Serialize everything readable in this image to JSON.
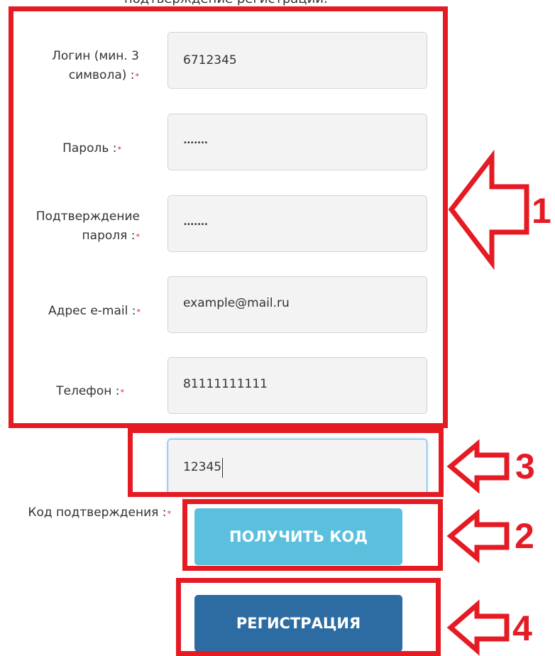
{
  "page": {
    "top_text": "подтверждение регистрации."
  },
  "form": {
    "required_mark": "*",
    "login": {
      "label_line1": "Логин (мин. 3",
      "label_line2": "символа) :",
      "value": "6712345"
    },
    "password": {
      "label": "Пароль :",
      "value": "•••••••"
    },
    "confirm_password": {
      "label_line1": "Подтверждение",
      "label_line2": "пароля :",
      "value": "•••••••"
    },
    "email": {
      "label": "Адрес e-mail :",
      "value": "example@mail.ru"
    },
    "phone": {
      "label": "Телефон :",
      "value": "81111111111"
    },
    "confirmation_code": {
      "label": "Код подтверждения :",
      "value": "12345"
    },
    "get_code_button": "ПОЛУЧИТЬ КОД",
    "register_button": "РЕГИСТРАЦИЯ"
  },
  "annotations": {
    "color": "#e51b24",
    "step_1": "1",
    "step_2": "2",
    "step_3": "3",
    "step_4": "4"
  }
}
